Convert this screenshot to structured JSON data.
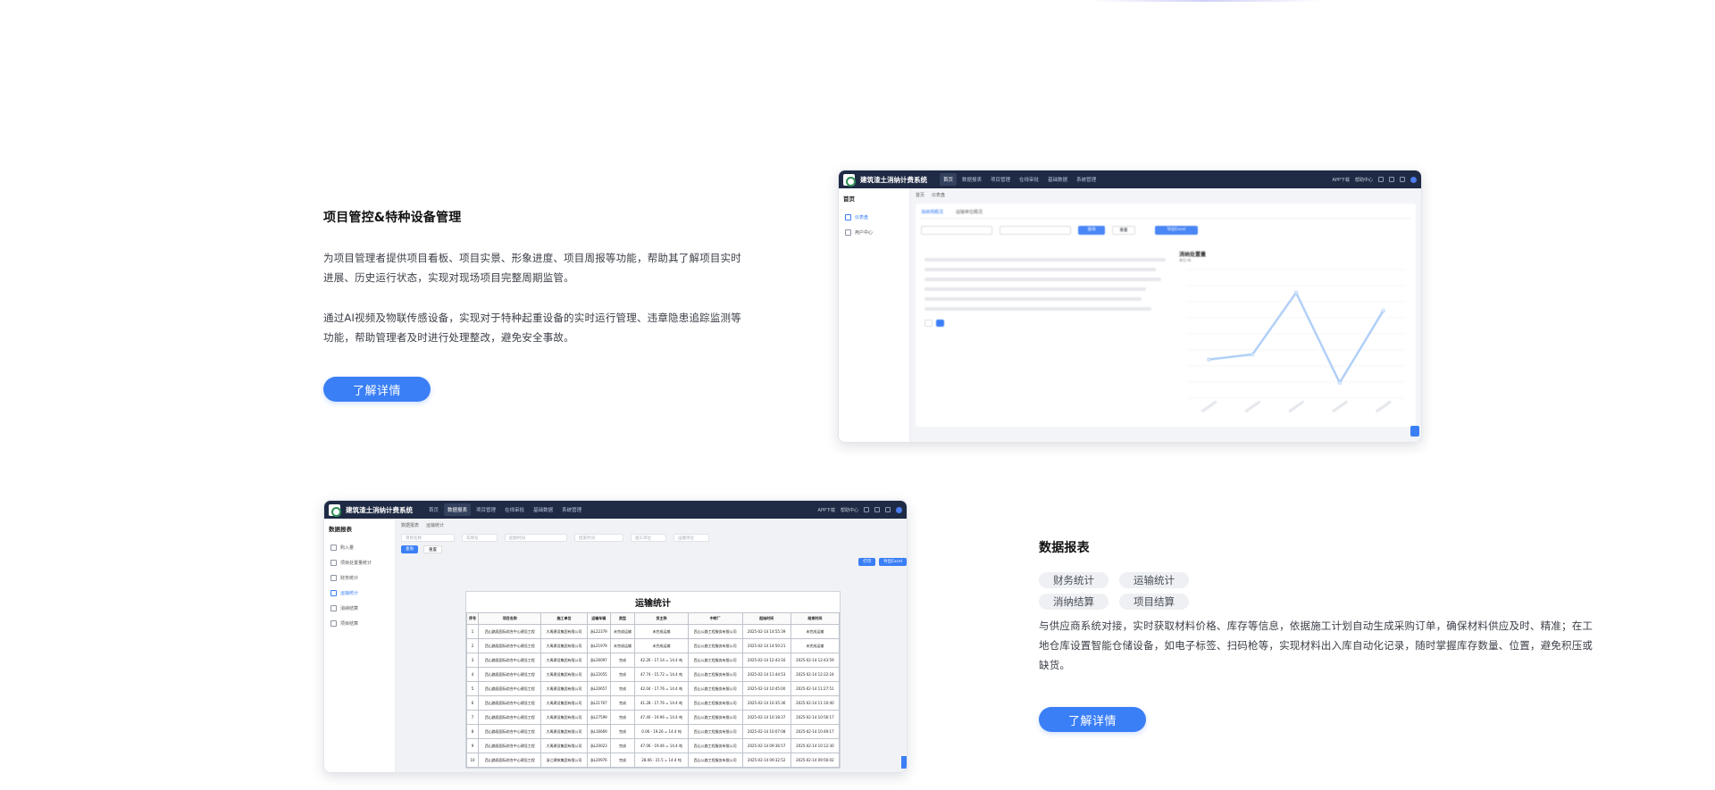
{
  "features": [
    {
      "title": "项目管控&特种设备管理",
      "paragraphs": [
        "为项目管理者提供项目看板、项目实景、形象进度、项目周报等功能，帮助其了解项目实时进展、历史运行状态，实现对现场项目完整周期监管。",
        "通过AI视频及物联传感设备，实现对于特种起重设备的实时运行管理、违章隐患追踪监测等功能，帮助管理者及时进行处理整改，避免安全事故。"
      ],
      "button": "了解详情"
    },
    {
      "title": "数据报表",
      "tags": [
        "财务统计",
        "运输统计",
        "消纳结算",
        "项目结算"
      ],
      "paragraphs": [
        "与供应商系统对接，实时获取材料价格、库存等信息，依据施工计划自动生成采购订单，确保材料供应及时、精准；在工地仓库设置智能仓储设备，如电子标签、扫码枪等，实现材料出入库自动化记录，随时掌握库存数量、位置，避免积压或缺货。"
      ],
      "button": "了解详情"
    }
  ],
  "screenshot1": {
    "app_title": "建筑渣土消纳计费系统",
    "nav": [
      "首页",
      "数据报表",
      "项目管理",
      "在线审批",
      "基础数据",
      "系统管理"
    ],
    "active_nav": 0,
    "right": [
      "APP下载",
      "帮助中心"
    ],
    "side_title": "首页",
    "side_items": [
      "仪表盘",
      "用户中心"
    ],
    "crumbs": [
      "首页",
      "仪表盘"
    ],
    "tabs": [
      "消纳场概况",
      "运输单位概况"
    ],
    "query": "查询",
    "reset": "重置",
    "export": "导出Excel",
    "chart_title": "消纳处置量",
    "chart_unit": "单位:吨",
    "chart_data": {
      "type": "line",
      "y": [
        30,
        34,
        82,
        12,
        68
      ],
      "ylim": [
        0,
        100
      ]
    }
  },
  "screenshot2": {
    "app_title": "建筑渣土消纳计费系统",
    "nav": [
      "首页",
      "数据报表",
      "项目管理",
      "在线审批",
      "基础数据",
      "系统管理"
    ],
    "active_nav": 1,
    "right": [
      "APP下载",
      "帮助中心"
    ],
    "side_title": "数据报表",
    "side_items": [
      "购入量",
      "项目处置量统计",
      "财务统计",
      "运输统计",
      "消纳结算",
      "项目结算"
    ],
    "active_side": 3,
    "crumbs": [
      "数据报表",
      "运输统计"
    ],
    "filters": [
      "项目名称",
      "车牌号",
      "",
      "起始时间",
      "结束时间",
      "施工单位",
      "运输单位"
    ],
    "query": "查询",
    "reset": "重置",
    "print": "打印",
    "export": "导出Excel",
    "sheet_title": "运输统计",
    "columns": [
      "序号",
      "项目名称",
      "施工单位",
      "运输车辆",
      "类型",
      "货主称",
      "中转厂",
      "起始时间",
      "结束时间"
    ],
    "rows": [
      [
        "1",
        "西山路段国际综合中心建设工程",
        "大禹建设集团有限公司",
        "浙L22379",
        "未完成运输",
        "未完成运输",
        "西山公路工程服务有限公司",
        "2025-02-14 14:55:39",
        "未完成运输"
      ],
      [
        "2",
        "西山路段国际综合中心建设工程",
        "大禹建设集团有限公司",
        "浙L21979",
        "未完成运输",
        "未完成运输",
        "西山公路工程服务有限公司",
        "2025-02-14 14:50:21",
        "未完成运输"
      ],
      [
        "3",
        "西山路段国际综合中心建设工程",
        "大禹建设集团有限公司",
        "浙L26097",
        "完成",
        "42.26 - 17.14 = 14.4 吨",
        "西山公路工程服务有限公司",
        "2025-02-14 12:43:16",
        "2025-02-14 12:43:59"
      ],
      [
        "4",
        "西山路段国际综合中心建设工程",
        "大禹建设集团有限公司",
        "浙L22055",
        "完成",
        "47.74 - 15.72 = 14.4 吨",
        "西山公路工程服务有限公司",
        "2025-02-14 11:44:53",
        "2025-02-14 12:22:24"
      ],
      [
        "5",
        "西山路段国际综合中心建设工程",
        "大禹建设集团有限公司",
        "浙L20657",
        "完成",
        "42.04 - 17.76 = 14.4 吨",
        "西山公路工程服务有限公司",
        "2025-02-14 10:45:00",
        "2025-02-14 11:27:51"
      ],
      [
        "6",
        "西山路段国际综合中心建设工程",
        "大禹建设集团有限公司",
        "浙L21767",
        "完成",
        "41.28 - 17.76 = 14.4 吨",
        "西山公路工程服务有限公司",
        "2025-02-14 10:35:36",
        "2025-02-14 11:10:40"
      ],
      [
        "7",
        "西山路段国际综合中心建设工程",
        "大禹建设集团有限公司",
        "浙L27599",
        "完成",
        "47.40 - 19.96 = 14.4 吨",
        "西山公路工程服务有限公司",
        "2025-02-14 10:18:37",
        "2025-02-14 10:56:17"
      ],
      [
        "8",
        "西山路段国际综合中心建设工程",
        "大禹建设集团有限公司",
        "浙L16669",
        "完成",
        "0.06 - 19.26 = 14.4 吨",
        "西山公路工程服务有限公司",
        "2025-02-14 10:07:08",
        "2025-02-14 10:49:17"
      ],
      [
        "9",
        "西山路段国际综合中心建设工程",
        "大禹建设集团有限公司",
        "浙L20023",
        "完成",
        "47.06 - 19.46 = 14.4 吨",
        "西山公路工程服务有限公司",
        "2025-02-14 09:36:57",
        "2025-02-14 10:12:30"
      ],
      [
        "10",
        "西山路段国际综合中心建设工程",
        "浙江建筑集团有限公司",
        "浙L20976",
        "完成",
        "28.06 - 21.5 = 14.4 吨",
        "西山公路工程服务有限公司",
        "2025-02-14 09:32:52",
        "2025-02-14 09:56:02"
      ]
    ]
  }
}
